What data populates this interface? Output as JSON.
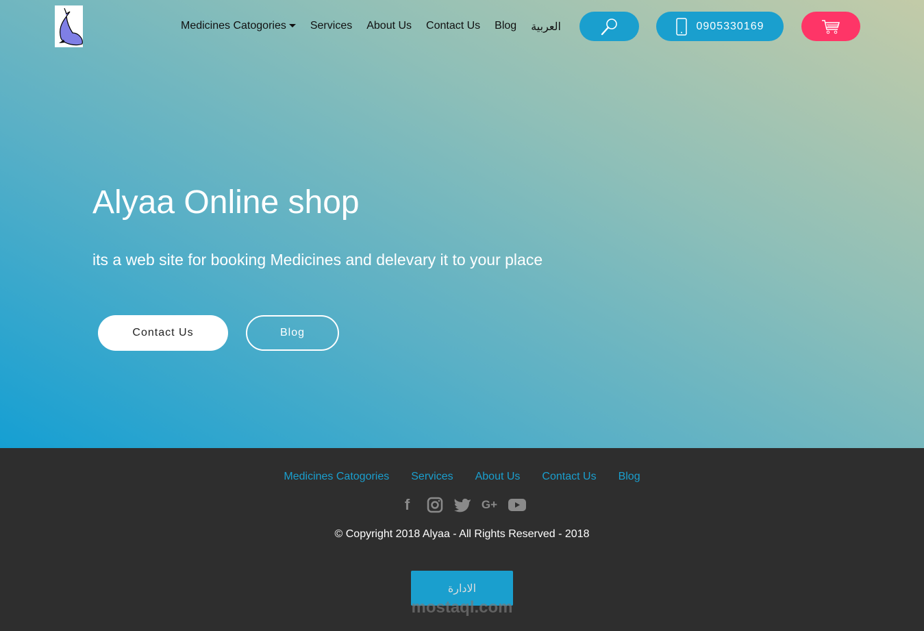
{
  "header": {
    "nav": [
      {
        "label": "Medicines Catogories"
      },
      {
        "label": "Services"
      },
      {
        "label": "About Us"
      },
      {
        "label": "Contact Us"
      },
      {
        "label": "Blog"
      },
      {
        "label": "العربية"
      }
    ],
    "phone": "0905330169",
    "search_icon": "search-icon",
    "cart_icon": "cart-icon"
  },
  "hero": {
    "title": "Alyaa Online shop",
    "subtitle": "its a web site for booking Medicines and delevary it to your place",
    "contact_label": "Contact Us",
    "blog_label": "Blog"
  },
  "footer": {
    "nav": [
      "Medicines Catogories",
      "Services",
      "About Us",
      "Contact Us",
      "Blog"
    ],
    "social": [
      "facebook",
      "instagram",
      "twitter",
      "google-plus",
      "youtube"
    ],
    "copyright": "© Copyright 2018 Alyaa - All Rights Reserved - 2018",
    "admin_label": "الادارة",
    "watermark": "mostaql.com"
  },
  "colors": {
    "accent": "#1a9fce",
    "cart": "#fe3567",
    "footer_bg": "#2e2e2e"
  }
}
